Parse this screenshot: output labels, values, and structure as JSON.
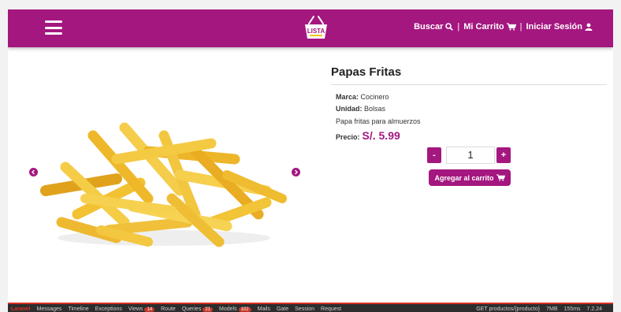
{
  "header": {
    "logo_text": "LISTA",
    "search_label": "Buscar",
    "cart_label": "Mi Carrito",
    "login_label": "Iniciar Sesión",
    "separator": "|"
  },
  "product": {
    "title": "Papas Fritas",
    "brand_label": "Marca:",
    "brand_value": "Cocinero",
    "unit_label": "Unidad:",
    "unit_value": "Bolsas",
    "description": "Papa fritas para almuerzos",
    "price_label": "Precio:",
    "price_value": "S/. 5.99",
    "quantity": "1",
    "decrement_label": "-",
    "increment_label": "+",
    "add_to_cart_label": "Agregar al carrito"
  },
  "debugbar": {
    "logo": "Laravel",
    "tabs": [
      {
        "label": "Messages"
      },
      {
        "label": "Timeline"
      },
      {
        "label": "Exceptions"
      },
      {
        "label": "Views",
        "badge": "14"
      },
      {
        "label": "Route"
      },
      {
        "label": "Queries",
        "badge": "21"
      },
      {
        "label": "Models",
        "badge": "102"
      },
      {
        "label": "Mails"
      },
      {
        "label": "Gate"
      },
      {
        "label": "Session"
      },
      {
        "label": "Request"
      }
    ],
    "route": "GET productos/{producto}",
    "memory": "7MB",
    "time": "155ms",
    "version": "7.2.24"
  },
  "colors": {
    "brand": "#a4177f",
    "background": "#ffffff"
  }
}
